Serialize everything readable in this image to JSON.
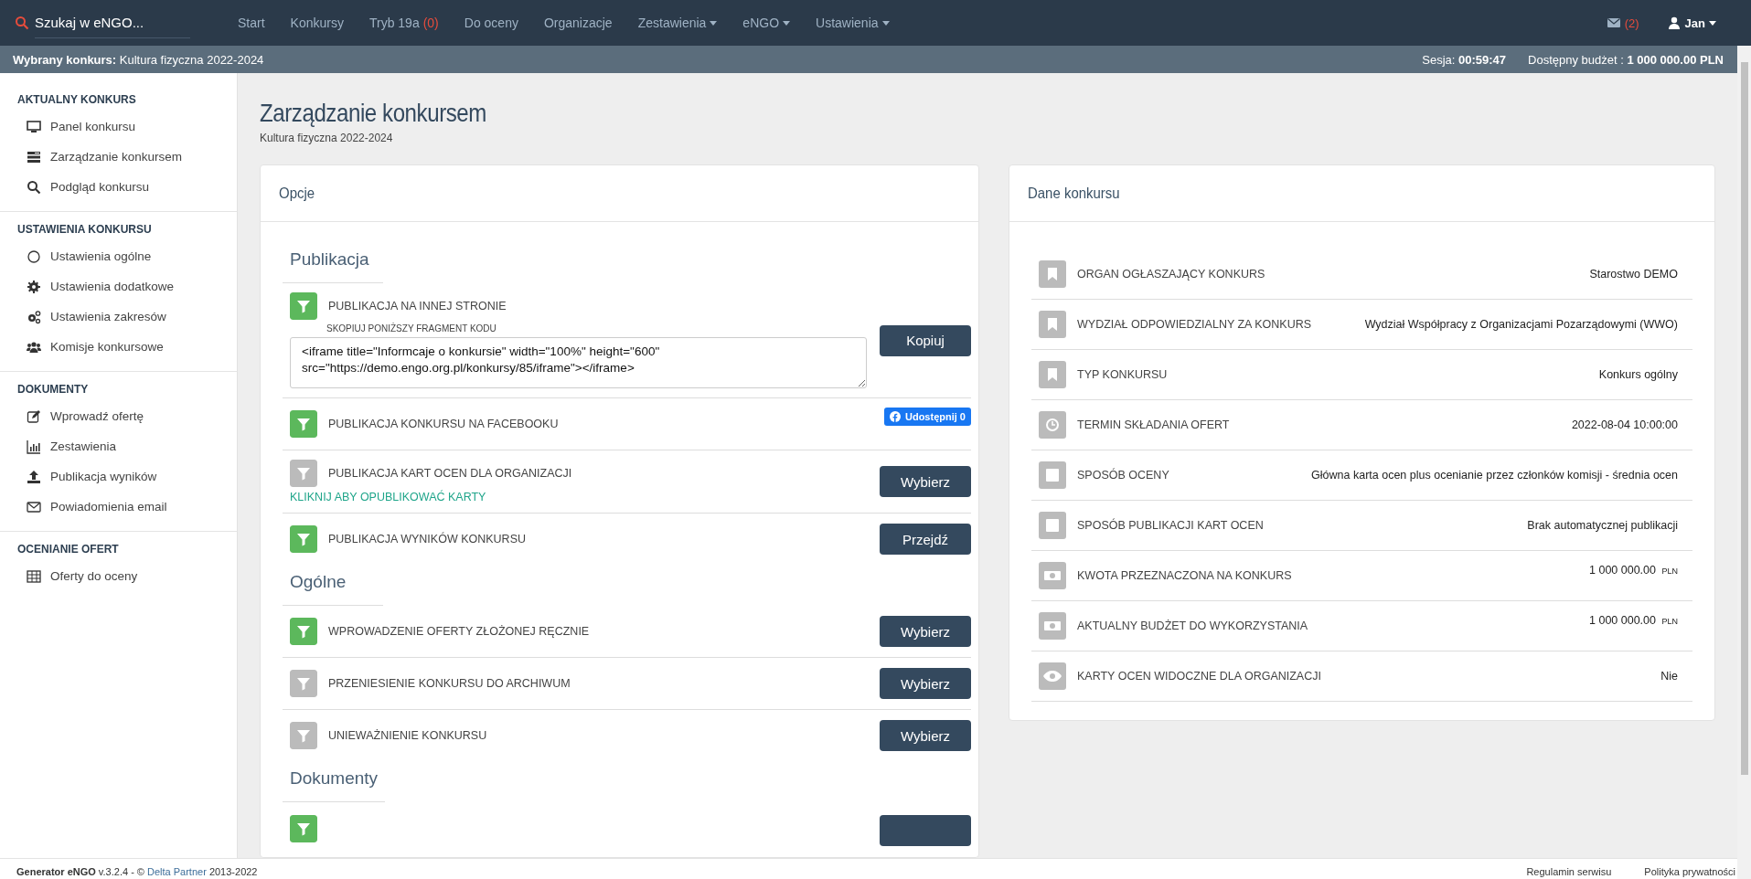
{
  "topbar": {
    "search": {
      "placeholder": "Szukaj w eNGO..."
    },
    "nav": [
      {
        "label": "Start"
      },
      {
        "label": "Konkursy"
      },
      {
        "label": "Tryb 19a",
        "badge": "(0)"
      },
      {
        "label": "Do oceny"
      },
      {
        "label": "Organizacje"
      },
      {
        "label": "Zestawienia",
        "dropdown": true
      },
      {
        "label": "eNGO",
        "dropdown": true
      },
      {
        "label": "Ustawienia",
        "dropdown": true
      }
    ],
    "messages": {
      "count": "(2)"
    },
    "user": {
      "name": "Jan",
      "dropdown": true
    }
  },
  "context_bar": {
    "contest": "**Wybrany konkurs:** Kultura fizyczna 2022-2024",
    "session": "Sesja: **00:59:47**",
    "budget": "Dostępny budżet : **1 000 000.00 PLN**"
  },
  "sidebar": [
    {
      "heading": "AKTUALNY KONKURS",
      "items": [
        {
          "label": "Panel konkursu"
        },
        {
          "label": "Zarządzanie konkursem"
        },
        {
          "label": "Podgląd konkursu"
        }
      ]
    },
    {
      "heading": "USTAWIENIA KONKURSU",
      "items": [
        {
          "label": "Ustawienia ogólne"
        },
        {
          "label": "Ustawienia dodatkowe"
        },
        {
          "label": "Ustawienia zakresów"
        },
        {
          "label": "Komisje konkursowe"
        }
      ]
    },
    {
      "heading": "DOKUMENTY",
      "items": [
        {
          "label": "Wprowadź ofertę"
        },
        {
          "label": "Zestawienia"
        },
        {
          "label": "Publikacja wyników"
        },
        {
          "label": "Powiadomienia email"
        }
      ]
    },
    {
      "heading": "OCENIANIE OFERT",
      "items": [
        {
          "label": "Oferty do oceny"
        }
      ]
    }
  ],
  "page": {
    "title": "Zarządzanie konkursem",
    "subtitle": "Kultura fizyczna 2022-2024"
  },
  "options": {
    "title": "Opcje",
    "sections": [
      {
        "title": "Publikacja",
        "items": [
          {
            "kind": "embed",
            "label": "PUBLIKACJA NA INNEJ STRONIE",
            "enabled": true,
            "hint": "SKOPIUJ PONIŻSZY FRAGMENT KODU",
            "code": "<iframe title=\"Informcaje o konkursie\" width=\"100%\" height=\"600\" src=\"https://demo.engo.org.pl/konkursy/85/iframe\"></iframe>",
            "button": "Kopiuj"
          },
          {
            "kind": "share",
            "label": "PUBLIKACJA KONKURSU NA FACEBOOKU",
            "enabled": true,
            "share_button": "Udostępnij 0"
          },
          {
            "kind": "action",
            "label": "PUBLIKACJA KART OCEN DLA ORGANIZACJI",
            "enabled": false,
            "link": "KLIKNIJ ABY OPUBLIKOWAĆ KARTY",
            "button": "Wybierz"
          },
          {
            "kind": "action",
            "label": "PUBLIKACJA WYNIKÓW KONKURSU",
            "enabled": true,
            "button": "Przejdź"
          }
        ]
      },
      {
        "title": "Ogólne",
        "items": [
          {
            "kind": "action",
            "label": "WPROWADZENIE OFERTY ZŁOŻONEJ RĘCZNIE",
            "enabled": true,
            "button": "Wybierz"
          },
          {
            "kind": "action",
            "label": "PRZENIESIENIE KONKURSU DO ARCHIWUM",
            "enabled": false,
            "button": "Wybierz"
          },
          {
            "kind": "action",
            "label": "UNIEWAŻNIENIE KONKURSU",
            "enabled": false,
            "button": "Wybierz"
          }
        ]
      },
      {
        "title": "Dokumenty",
        "items": [
          {
            "kind": "action",
            "enabled": true
          }
        ]
      }
    ]
  },
  "details": {
    "title": "Dane konkursu",
    "rows": [
      {
        "label": "ORGAN OGŁASZAJĄCY KONKURS",
        "value": "Starostwo DEMO"
      },
      {
        "label": "WYDZIAŁ ODPOWIEDZIALNY ZA KONKURS",
        "value": "Wydział Współpracy z Organizacjami Pozarządowymi (WWO)"
      },
      {
        "label": "TYP KONKURSU",
        "value": "Konkurs ogólny"
      },
      {
        "label": "TERMIN SKŁADANIA OFERT",
        "value": "2022-08-04 10:00:00"
      },
      {
        "label": "SPOSÓB OCENY",
        "value": "Główna karta ocen plus ocenianie przez członków komisji - średnia ocen"
      },
      {
        "label": "SPOSÓB PUBLIKACJI KART OCEN",
        "value": "Brak automatycznej publikacji"
      },
      {
        "label": "KWOTA PRZEZNACZONA NA KONKURS",
        "value": "1 000 000.00",
        "unit": "PLN"
      },
      {
        "label": "AKTUALNY BUDŻET DO WYKORZYSTANIA",
        "value": "1 000 000.00",
        "unit": "PLN"
      },
      {
        "label": "KARTY OCEN WIDOCZNE DLA ORGANIZACJI",
        "value": "Nie"
      }
    ]
  },
  "footer": {
    "before": "**Generator eNGO** v.3.2.4 - © ",
    "link": "Delta Partner",
    "after": " 2013-2022",
    "links": [
      "Regulamin serwisu",
      "Polityka prywatności"
    ]
  }
}
